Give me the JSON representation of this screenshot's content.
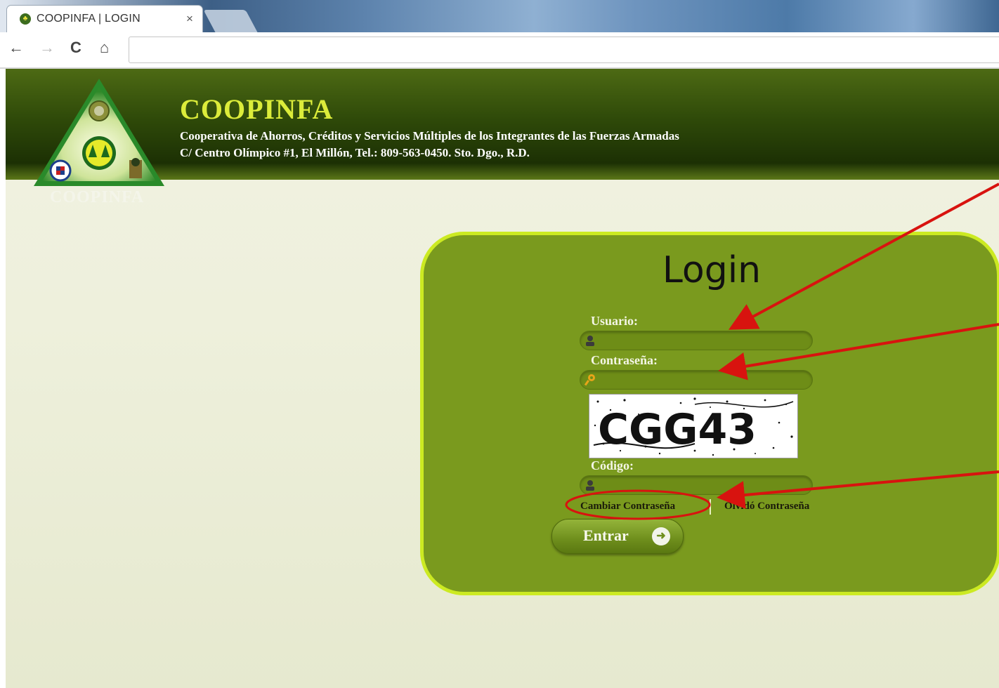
{
  "browser": {
    "tab_title": "COOPINFA | LOGIN",
    "tab_close": "×",
    "back_icon": "←",
    "forward_icon": "→",
    "reload_icon": "C",
    "home_icon": "⌂",
    "favicon": "♣"
  },
  "header": {
    "title": "COOPINFA",
    "subtitle": "Cooperativa de Ahorros, Créditos y Servicios Múltiples de los Integrantes de las Fuerzas Armadas",
    "address": "C/ Centro Olímpico #1, El Millón, Tel.: 809-563-0450. Sto. Dgo., R.D.",
    "logo_text": "COOPINFA"
  },
  "login": {
    "title": "Login",
    "username_label": "Usuario:",
    "password_label": "Contraseña:",
    "captcha_text": "CGG43",
    "code_label": "Código:",
    "change_password": "Cambiar Contraseña",
    "forgot_password": "Olvidó Contraseña",
    "submit": "Entrar",
    "submit_icon": "➜"
  },
  "colors": {
    "header_green": "#2f4a09",
    "title_yellow": "#dcec3a",
    "panel_green": "#7a9a1e",
    "panel_border": "#ccea22",
    "annotation_red": "#d8130f"
  }
}
